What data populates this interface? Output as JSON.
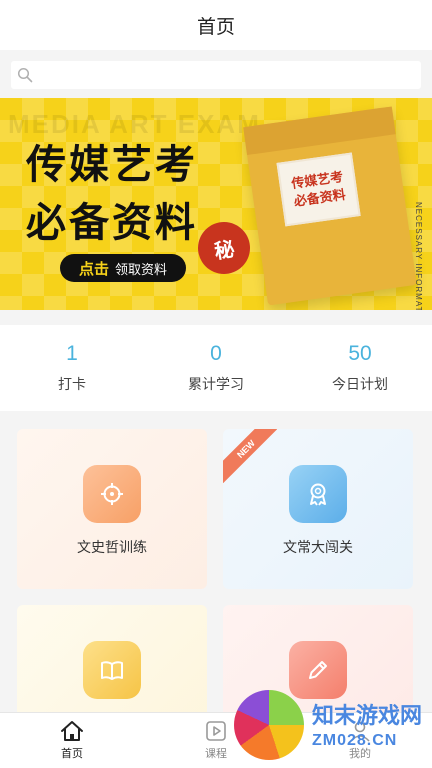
{
  "header": {
    "title": "首页"
  },
  "search": {
    "placeholder": ""
  },
  "banner": {
    "ghost_text": "MEDIA ART EXAM",
    "headline_1": "传媒艺考",
    "headline_2": "必备资料",
    "cta_prefix": "点击",
    "cta_label": "领取资料",
    "seal": "秘",
    "packet_line_1": "传媒艺考",
    "packet_line_2": "必备资料",
    "side_text": "NECESSARY INFORMATION"
  },
  "stats": [
    {
      "value": "1",
      "label": "打卡"
    },
    {
      "value": "0",
      "label": "累计学习"
    },
    {
      "value": "50",
      "label": "今日计划"
    }
  ],
  "cards": [
    {
      "label": "文史哲训练",
      "icon": "crosshair-icon",
      "color": "#f7a066"
    },
    {
      "label": "文常大闯关",
      "icon": "award-medal-icon",
      "color": "#5caee9",
      "badge": "NEW"
    },
    {
      "label": "",
      "icon": "book-icon",
      "color": "#f6c446"
    },
    {
      "label": "",
      "icon": "pencil-icon",
      "color": "#f47f6c"
    }
  ],
  "tabbar": [
    {
      "label": "首页",
      "icon": "home-icon",
      "active": true
    },
    {
      "label": "课程",
      "icon": "video-play-icon",
      "active": false
    },
    {
      "label": "我的",
      "icon": "user-icon",
      "active": false
    }
  ],
  "watermark": {
    "line_1": "知末游戏网",
    "line_2": "ZM028.CN"
  },
  "colors": {
    "accent": "#4ab3dd",
    "banner_yellow": "#f6d21a",
    "tab_active": "#222222"
  }
}
